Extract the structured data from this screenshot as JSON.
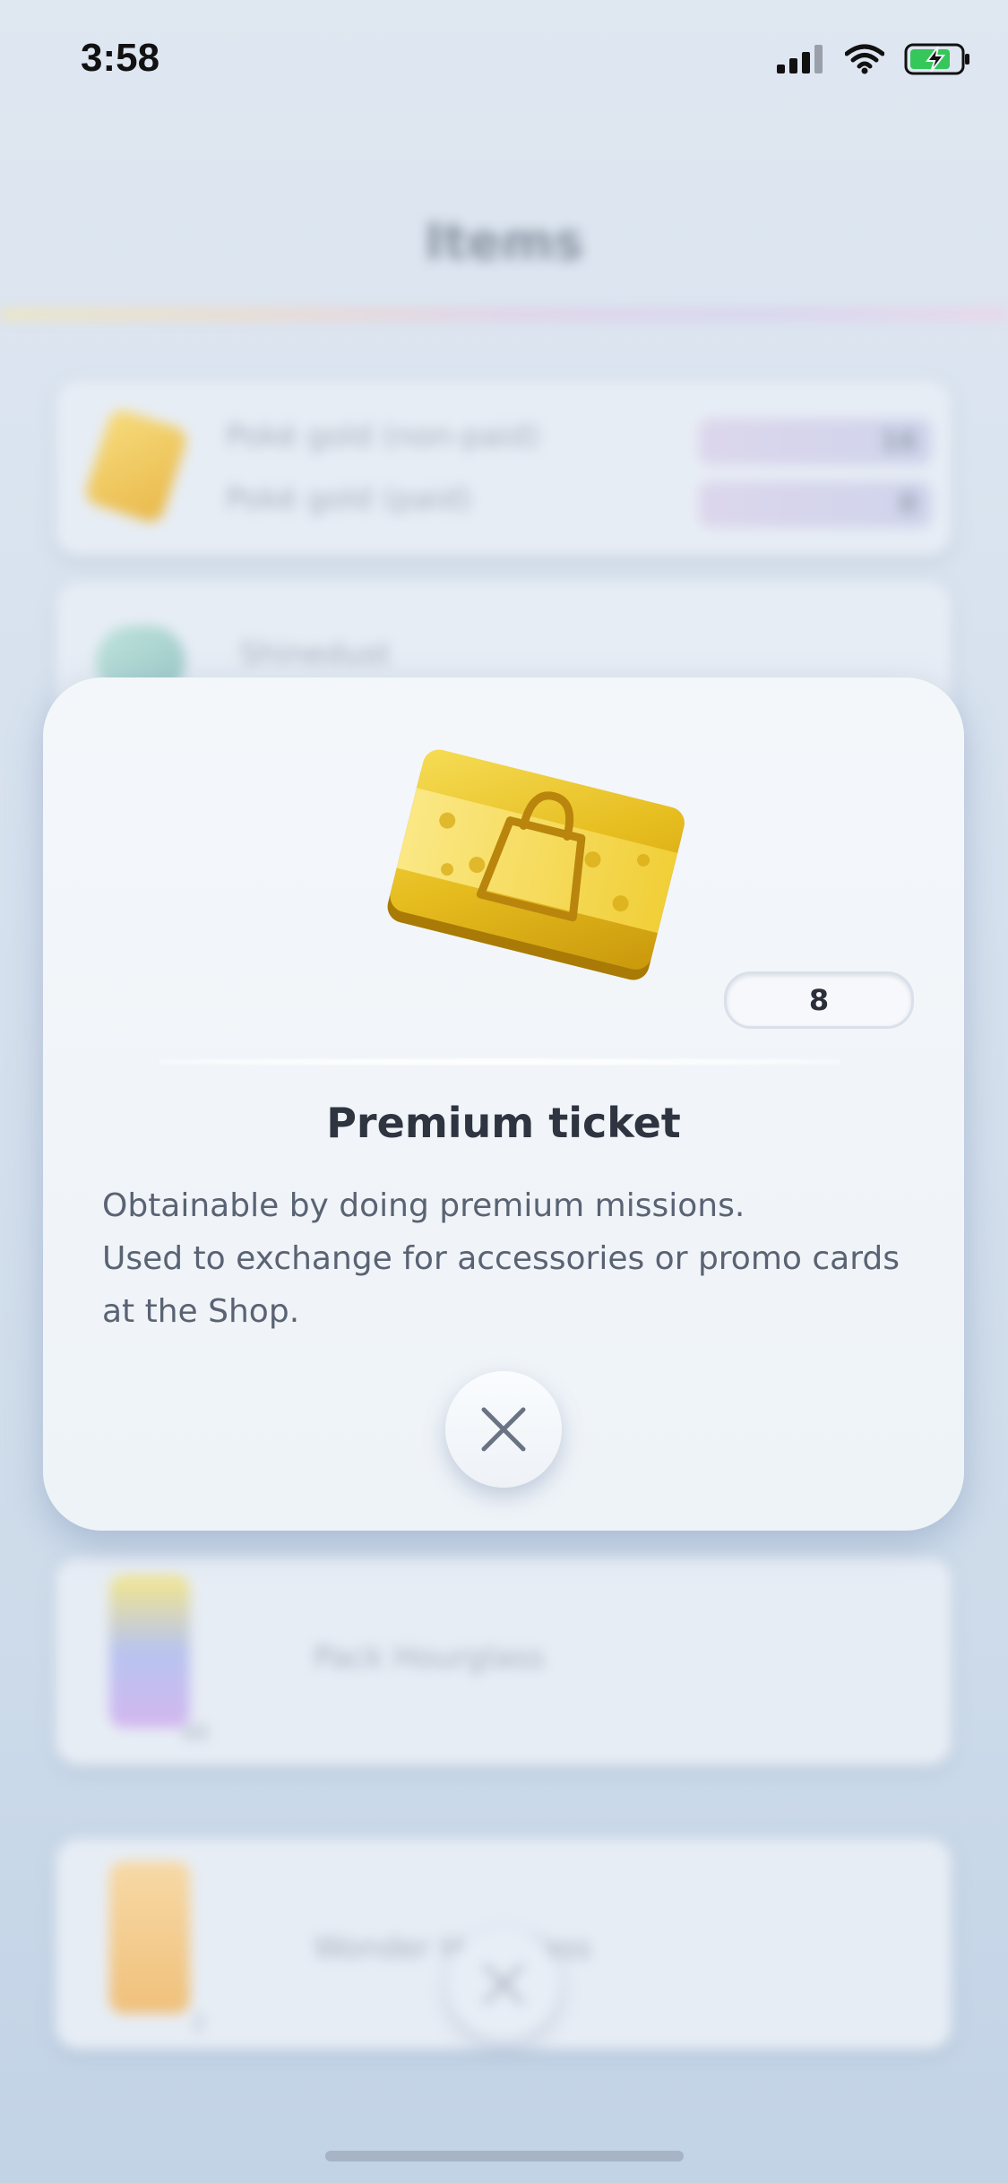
{
  "status_bar": {
    "time": "3:58"
  },
  "background": {
    "title": "Items",
    "rows": [
      {
        "label": "Poké gold (non-paid)",
        "value": "16"
      },
      {
        "label": "Poké gold (paid)",
        "value": "0"
      }
    ],
    "cards": [
      {
        "label": "Shinedust"
      },
      {
        "label": "Pack Hourglass",
        "count": "49"
      },
      {
        "label": "Wonder Hourglass",
        "count": "2"
      }
    ]
  },
  "modal": {
    "quantity": "8",
    "item_name": "Premium ticket",
    "description": "Obtainable by doing premium missions.\nUsed to exchange for accessories or promo cards at the Shop."
  },
  "colors": {
    "modal_bg": "#f1f5f9",
    "title_text": "#2e3440",
    "body_text": "#5a6373",
    "ticket_gold": "#e3b51c"
  },
  "icons": {
    "close": "close-icon",
    "ticket": "premium-ticket-icon",
    "battery": "battery-charging-icon",
    "wifi": "wifi-icon",
    "signal": "signal-icon"
  }
}
